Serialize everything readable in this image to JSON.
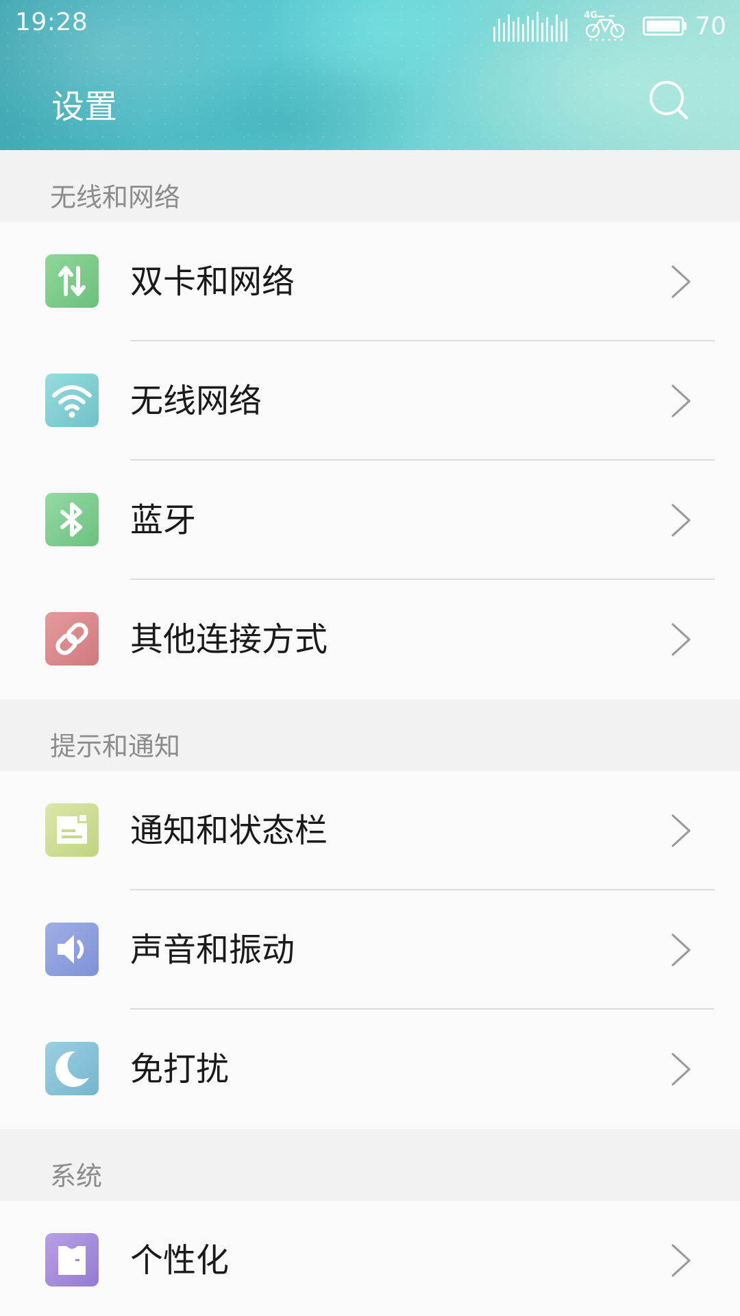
{
  "status_bar": {
    "time": "19:28",
    "network_type": "4G",
    "battery_level": "70"
  },
  "header": {
    "title": "设置"
  },
  "sections": [
    {
      "title": "无线和网络",
      "items": [
        {
          "label": "双卡和网络",
          "icon": "dual-sim-data-icon",
          "color": "#7dcc8d"
        },
        {
          "label": "无线网络",
          "icon": "wifi-icon",
          "color": "#82cfd3"
        },
        {
          "label": "蓝牙",
          "icon": "bluetooth-icon",
          "color": "#7fd191"
        },
        {
          "label": "其他连接方式",
          "icon": "link-icon",
          "color": "#d98a8c"
        }
      ]
    },
    {
      "title": "提示和通知",
      "items": [
        {
          "label": "通知和状态栏",
          "icon": "notification-icon",
          "color": "#cfdf93"
        },
        {
          "label": "声音和振动",
          "icon": "speaker-icon",
          "color": "#8e9fdf"
        },
        {
          "label": "免打扰",
          "icon": "moon-icon",
          "color": "#87c3da"
        }
      ]
    },
    {
      "title": "系统",
      "items": [
        {
          "label": "个性化",
          "icon": "shirt-icon",
          "color": "#a78fdc"
        }
      ]
    }
  ]
}
